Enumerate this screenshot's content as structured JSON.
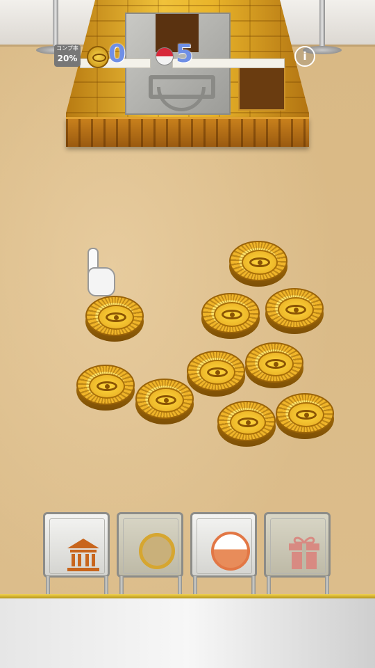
{
  "hud": {
    "completion_label": "コンプ率",
    "completion_value": "20%",
    "coin_count": "0",
    "capsule_count": "5",
    "info_label": "i"
  },
  "board": {
    "coin_icon": "eye-coin-icon",
    "hand_icon": "pointing-hand-icon"
  },
  "menu": {
    "items": [
      {
        "name": "museum",
        "icon": "museum-icon"
      },
      {
        "name": "coin",
        "icon": "coin-icon"
      },
      {
        "name": "capsule",
        "icon": "capsule-icon"
      },
      {
        "name": "gift",
        "icon": "gift-icon"
      }
    ]
  },
  "colors": {
    "hud_number": "#6f8fe6",
    "gold": "#e9b42a",
    "sand": "#dcbd8b",
    "menu_accent": "#e27745"
  }
}
